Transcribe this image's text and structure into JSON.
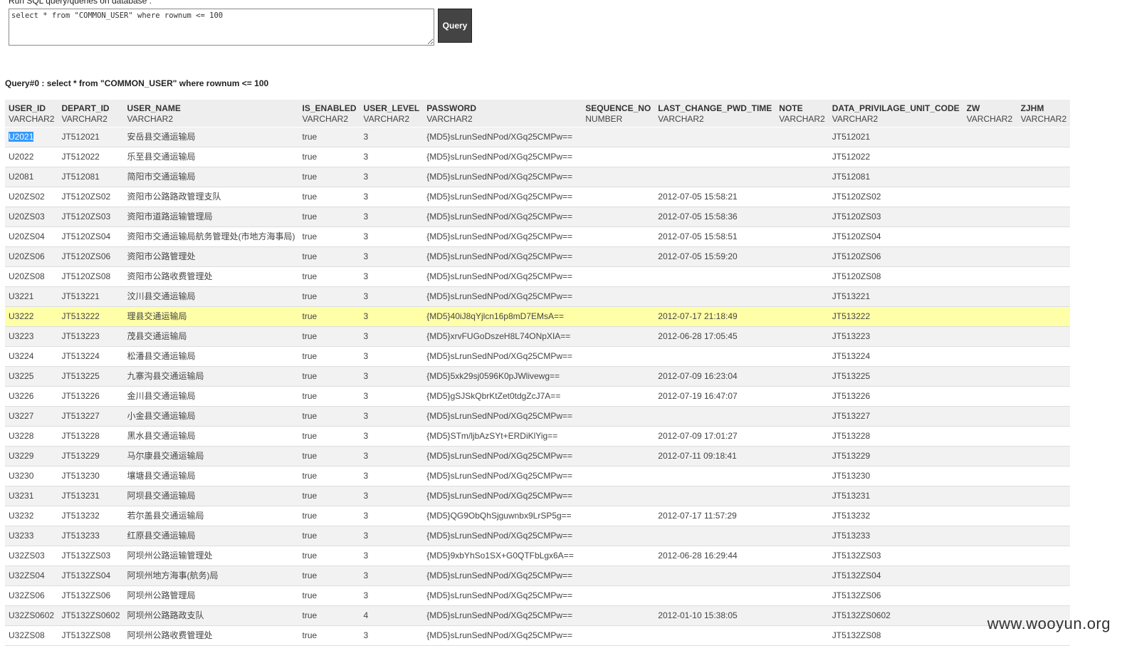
{
  "query_form": {
    "label": "Run SQL query/queries on database :",
    "sql": "select * from \"COMMON_USER\" where rownum <= 100",
    "button": "Query"
  },
  "result": {
    "title": "Query#0 : select * from \"COMMON_USER\" where rownum <= 100",
    "columns": [
      {
        "name": "USER_ID",
        "type": "VARCHAR2"
      },
      {
        "name": "DEPART_ID",
        "type": "VARCHAR2"
      },
      {
        "name": "USER_NAME",
        "type": "VARCHAR2"
      },
      {
        "name": "IS_ENABLED",
        "type": "VARCHAR2"
      },
      {
        "name": "USER_LEVEL",
        "type": "VARCHAR2"
      },
      {
        "name": "PASSWORD",
        "type": "VARCHAR2"
      },
      {
        "name": "SEQUENCE_NO",
        "type": "NUMBER"
      },
      {
        "name": "LAST_CHANGE_PWD_TIME",
        "type": "VARCHAR2"
      },
      {
        "name": "NOTE",
        "type": "VARCHAR2"
      },
      {
        "name": "DATA_PRIVILAGE_UNIT_CODE",
        "type": "VARCHAR2"
      },
      {
        "name": "ZW",
        "type": "VARCHAR2"
      },
      {
        "name": "ZJHM",
        "type": "VARCHAR2"
      }
    ],
    "highlighted_row": 9,
    "rows": [
      [
        "U2021",
        "JT512021",
        "安岳县交通运输局",
        "true",
        "3",
        "{MD5}sLrunSedNPod/XGq25CMPw==",
        "",
        "",
        "",
        "JT512021",
        "",
        ""
      ],
      [
        "U2022",
        "JT512022",
        "乐至县交通运输局",
        "true",
        "3",
        "{MD5}sLrunSedNPod/XGq25CMPw==",
        "",
        "",
        "",
        "JT512022",
        "",
        ""
      ],
      [
        "U2081",
        "JT512081",
        "简阳市交通运输局",
        "true",
        "3",
        "{MD5}sLrunSedNPod/XGq25CMPw==",
        "",
        "",
        "",
        "JT512081",
        "",
        ""
      ],
      [
        "U20ZS02",
        "JT5120ZS02",
        "资阳市公路路政管理支队",
        "true",
        "3",
        "{MD5}sLrunSedNPod/XGq25CMPw==",
        "",
        "2012-07-05 15:58:21",
        "",
        "JT5120ZS02",
        "",
        ""
      ],
      [
        "U20ZS03",
        "JT5120ZS03",
        "资阳市道路运输管理局",
        "true",
        "3",
        "{MD5}sLrunSedNPod/XGq25CMPw==",
        "",
        "2012-07-05 15:58:36",
        "",
        "JT5120ZS03",
        "",
        ""
      ],
      [
        "U20ZS04",
        "JT5120ZS04",
        "资阳市交通运输局航务管理处(市地方海事局)",
        "true",
        "3",
        "{MD5}sLrunSedNPod/XGq25CMPw==",
        "",
        "2012-07-05 15:58:51",
        "",
        "JT5120ZS04",
        "",
        ""
      ],
      [
        "U20ZS06",
        "JT5120ZS06",
        "资阳市公路管理处",
        "true",
        "3",
        "{MD5}sLrunSedNPod/XGq25CMPw==",
        "",
        "2012-07-05 15:59:20",
        "",
        "JT5120ZS06",
        "",
        ""
      ],
      [
        "U20ZS08",
        "JT5120ZS08",
        "资阳市公路收费管理处",
        "true",
        "3",
        "{MD5}sLrunSedNPod/XGq25CMPw==",
        "",
        "",
        "",
        "JT5120ZS08",
        "",
        ""
      ],
      [
        "U3221",
        "JT513221",
        "汶川县交通运输局",
        "true",
        "3",
        "{MD5}sLrunSedNPod/XGq25CMPw==",
        "",
        "",
        "",
        "JT513221",
        "",
        ""
      ],
      [
        "U3222",
        "JT513222",
        "理县交通运输局",
        "true",
        "3",
        "{MD5}40iJ8qYjlcn16p8mD7EMsA==",
        "",
        "2012-07-17 21:18:49",
        "",
        "JT513222",
        "",
        ""
      ],
      [
        "U3223",
        "JT513223",
        "茂县交通运输局",
        "true",
        "3",
        "{MD5}xrvFUGoDszeH8L74ONpXIA==",
        "",
        "2012-06-28 17:05:45",
        "",
        "JT513223",
        "",
        ""
      ],
      [
        "U3224",
        "JT513224",
        "松潘县交通运输局",
        "true",
        "3",
        "{MD5}sLrunSedNPod/XGq25CMPw==",
        "",
        "",
        "",
        "JT513224",
        "",
        ""
      ],
      [
        "U3225",
        "JT513225",
        "九寨沟县交通运输局",
        "true",
        "3",
        "{MD5}5xk29sj0596K0pJWlivewg==",
        "",
        "2012-07-09 16:23:04",
        "",
        "JT513225",
        "",
        ""
      ],
      [
        "U3226",
        "JT513226",
        "金川县交通运输局",
        "true",
        "3",
        "{MD5}gSJSkQbrKtZet0tdgZcJ7A==",
        "",
        "2012-07-19 16:47:07",
        "",
        "JT513226",
        "",
        ""
      ],
      [
        "U3227",
        "JT513227",
        "小金县交通运输局",
        "true",
        "3",
        "{MD5}sLrunSedNPod/XGq25CMPw==",
        "",
        "",
        "",
        "JT513227",
        "",
        ""
      ],
      [
        "U3228",
        "JT513228",
        "黑水县交通运输局",
        "true",
        "3",
        "{MD5}STm/ljbAzSYt+ERDiKlYig==",
        "",
        "2012-07-09 17:01:27",
        "",
        "JT513228",
        "",
        ""
      ],
      [
        "U3229",
        "JT513229",
        "马尔康县交通运输局",
        "true",
        "3",
        "{MD5}sLrunSedNPod/XGq25CMPw==",
        "",
        "2012-07-11 09:18:41",
        "",
        "JT513229",
        "",
        ""
      ],
      [
        "U3230",
        "JT513230",
        "壤塘县交通运输局",
        "true",
        "3",
        "{MD5}sLrunSedNPod/XGq25CMPw==",
        "",
        "",
        "",
        "JT513230",
        "",
        ""
      ],
      [
        "U3231",
        "JT513231",
        "阿坝县交通运输局",
        "true",
        "3",
        "{MD5}sLrunSedNPod/XGq25CMPw==",
        "",
        "",
        "",
        "JT513231",
        "",
        ""
      ],
      [
        "U3232",
        "JT513232",
        "若尔盖县交通运输局",
        "true",
        "3",
        "{MD5}QG9ObQhSjguwnbx9LrSP5g==",
        "",
        "2012-07-17 11:57:29",
        "",
        "JT513232",
        "",
        ""
      ],
      [
        "U3233",
        "JT513233",
        "红原县交通运输局",
        "true",
        "3",
        "{MD5}sLrunSedNPod/XGq25CMPw==",
        "",
        "",
        "",
        "JT513233",
        "",
        ""
      ],
      [
        "U32ZS03",
        "JT5132ZS03",
        "阿坝州公路运输管理处",
        "true",
        "3",
        "{MD5}9xbYhSo1SX+G0QTFbLgx6A==",
        "",
        "2012-06-28 16:29:44",
        "",
        "JT5132ZS03",
        "",
        ""
      ],
      [
        "U32ZS04",
        "JT5132ZS04",
        "阿坝州地方海事(航务)局",
        "true",
        "3",
        "{MD5}sLrunSedNPod/XGq25CMPw==",
        "",
        "",
        "",
        "JT5132ZS04",
        "",
        ""
      ],
      [
        "U32ZS06",
        "JT5132ZS06",
        "阿坝州公路管理局",
        "true",
        "3",
        "{MD5}sLrunSedNPod/XGq25CMPw==",
        "",
        "",
        "",
        "JT5132ZS06",
        "",
        ""
      ],
      [
        "U32ZS0602",
        "JT5132ZS0602",
        "阿坝州公路路政支队",
        "true",
        "4",
        "{MD5}sLrunSedNPod/XGq25CMPw==",
        "",
        "2012-01-10 15:38:05",
        "",
        "JT5132ZS0602",
        "",
        ""
      ],
      [
        "U32ZS08",
        "JT5132ZS08",
        "阿坝州公路收费管理处",
        "true",
        "3",
        "{MD5}sLrunSedNPod/XGq25CMPw==",
        "",
        "",
        "",
        "JT5132ZS08",
        "",
        ""
      ]
    ]
  },
  "watermark": "www.wooyun.org"
}
